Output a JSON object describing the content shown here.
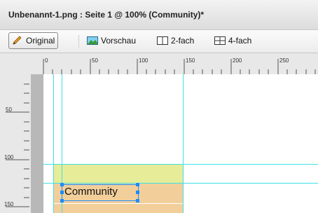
{
  "window": {
    "title": "Unbenannt-1.png : Seite 1 @ 100% (Community)*"
  },
  "toolbar": {
    "original": {
      "label": "Original",
      "icon": "pencil-icon"
    },
    "preview": {
      "label": "Vorschau",
      "icon": "image-icon"
    },
    "two_up": {
      "label": "2-fach",
      "icon": "split-2-icon"
    },
    "four_up": {
      "label": "4-fach",
      "icon": "split-4-icon"
    }
  },
  "ruler": {
    "h_labels": [
      "0",
      "50",
      "100",
      "150",
      "200",
      "250"
    ],
    "v_labels": [
      "50",
      "100",
      "150"
    ]
  },
  "canvas": {
    "text_label": "Community",
    "colors": {
      "guide": "#3fe0e6",
      "yellow": "#e6ec98",
      "orange": "#f2cf9a",
      "selection": "#1a8cff"
    }
  }
}
